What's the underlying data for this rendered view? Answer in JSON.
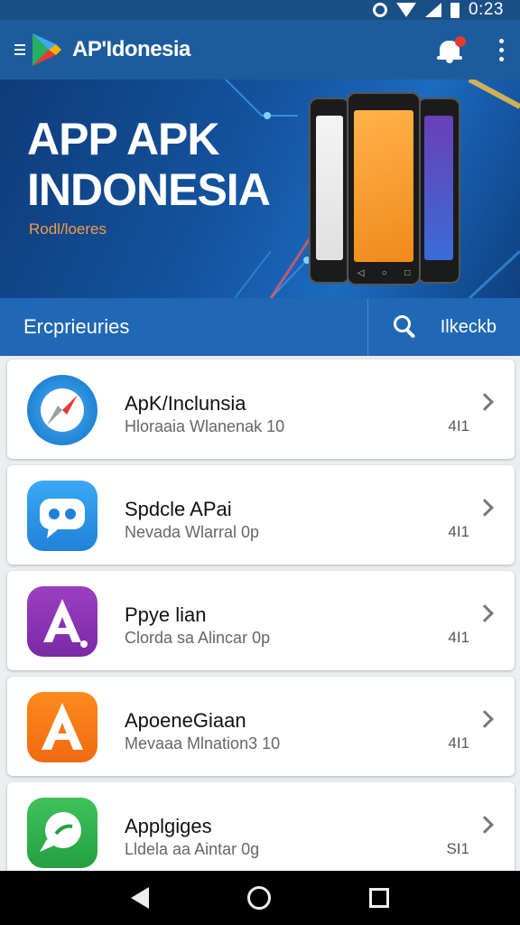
{
  "status_bar": {
    "time": "0:23"
  },
  "app_bar": {
    "title": "AP'Idonesia"
  },
  "banner": {
    "title_line1": "APP APK",
    "title_line2": "INDONESIA",
    "subtitle": "Rodl/loeres"
  },
  "tab_bar": {
    "label": "Ercprieuries",
    "right_label": "Ilkeckb"
  },
  "apps": [
    {
      "name": "ApK/Inclunsia",
      "desc": "Hloraaia Wlanenak 10",
      "count": "4I1",
      "icon": "compass-icon"
    },
    {
      "name": "Spdcle APai",
      "desc": "Nevada Wlarral 0p",
      "count": "4I1",
      "icon": "chat-bubble-icon"
    },
    {
      "name": "Ppye lian",
      "desc": "Clorda sa Alincar 0p",
      "count": "4I1",
      "icon": "letter-a-purple-icon"
    },
    {
      "name": "ApoeneGiaan",
      "desc": "Mevaaa Mlnation3 10",
      "count": "4I1",
      "icon": "letter-a-orange-icon"
    },
    {
      "name": "Applgiges",
      "desc": "Lldela aa Aintar 0g",
      "count": "SI1",
      "icon": "speech-bubble-icon"
    }
  ],
  "colors": {
    "status_bar": "#1a4f86",
    "app_bar": "#1d5c9c",
    "tab_bar": "#2068b4",
    "banner_subtitle": "#f0a040",
    "notification_dot": "#e53935"
  }
}
